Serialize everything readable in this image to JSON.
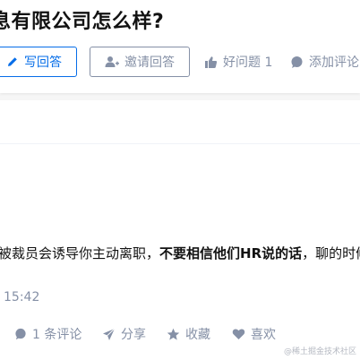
{
  "question": {
    "title": "息有限公司怎么样?",
    "write_answer_label": "写回答",
    "invite_answer_label": "邀请回答",
    "good_question_label": "好问题 1",
    "add_comment_label": "添加评论"
  },
  "answer": {
    "text_before": "被裁员会诱导你主动离职，",
    "text_bold": "不要相信他们HR说的话",
    "text_after": "，聊的时候",
    "time": "15:42",
    "comments_label": "1 条评论",
    "share_label": "分享",
    "favorite_label": "收藏",
    "like_label": "喜欢"
  },
  "watermark": "@稀土掘金技术社区",
  "icons": {
    "pen": "pencil-icon",
    "invite": "add-user-icon",
    "thumb": "thumbs-up-icon",
    "bubble": "comment-bubble-icon",
    "share": "paper-plane-icon",
    "star": "star-icon",
    "heart": "heart-icon"
  },
  "colors": {
    "primary": "#056de8",
    "muted": "#8590a6",
    "text": "#121212",
    "background": "#f6f6f6"
  }
}
